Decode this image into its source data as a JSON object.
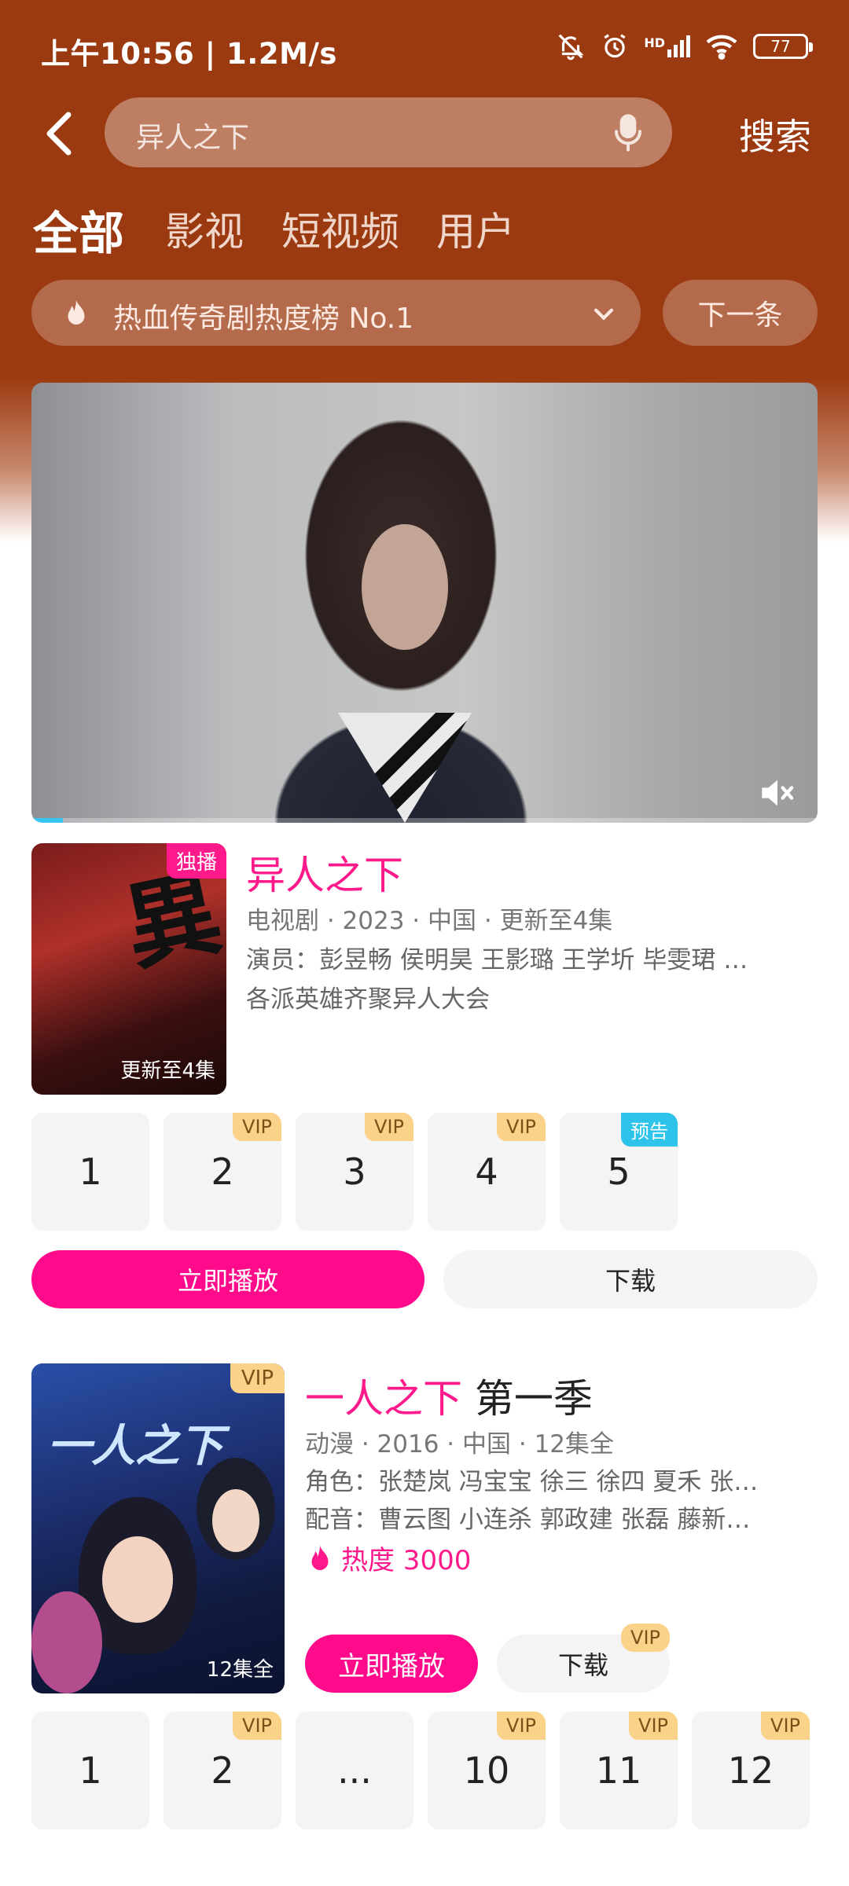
{
  "status": {
    "time": "上午10:56 | 1.2M/s",
    "battery": "77",
    "network": "HD"
  },
  "header": {
    "search_value": "异人之下",
    "search_button": "搜索"
  },
  "tabs": [
    {
      "label": "全部",
      "active": true
    },
    {
      "label": "影视",
      "active": false
    },
    {
      "label": "短视频",
      "active": false
    },
    {
      "label": "用户",
      "active": false
    }
  ],
  "hot_banner": {
    "text": "热血传奇剧热度榜 No.1",
    "next_label": "下一条"
  },
  "video": {
    "progress_fraction": 0.04,
    "accent_color": "#35c6f4"
  },
  "show1": {
    "badge": "独播",
    "poster_caption": "更新至4集",
    "title": "异人之下",
    "meta": "电视剧 · 2023 · 中国 · 更新至4集",
    "cast": "演员：彭昱畅 侯明昊 王影璐 王学圻 毕雯珺 …",
    "desc": "各派英雄齐聚异人大会",
    "episodes": [
      {
        "num": "1",
        "tag": ""
      },
      {
        "num": "2",
        "tag": "VIP"
      },
      {
        "num": "3",
        "tag": "VIP"
      },
      {
        "num": "4",
        "tag": "VIP"
      },
      {
        "num": "5",
        "tag": "预告"
      }
    ],
    "play_label": "立即播放",
    "download_label": "下载"
  },
  "show2": {
    "badge": "VIP",
    "poster_caption": "12集全",
    "title_highlight": "一人之下",
    "title_rest": " 第一季",
    "meta": "动漫 · 2016 · 中国 · 12集全",
    "roles": "角色：张楚岚 冯宝宝 徐三 徐四 夏禾 张…",
    "voice": "配音：曹云图 小连杀 郭政建 张磊 藤新…",
    "heat": "热度 3000",
    "play_label": "立即播放",
    "download_label": "下载",
    "download_badge": "VIP",
    "episodes": [
      {
        "num": "1",
        "tag": ""
      },
      {
        "num": "2",
        "tag": "VIP"
      },
      {
        "num": "...",
        "tag": ""
      },
      {
        "num": "10",
        "tag": "VIP"
      },
      {
        "num": "11",
        "tag": "VIP"
      },
      {
        "num": "12",
        "tag": "VIP"
      }
    ]
  },
  "colors": {
    "header_bg": "#9b3a10",
    "accent_pink": "#ff1a8c",
    "play_button": "#ff0a8a",
    "vip_tag": "#fbd28a",
    "preview_tag": "#2dc3ea"
  }
}
